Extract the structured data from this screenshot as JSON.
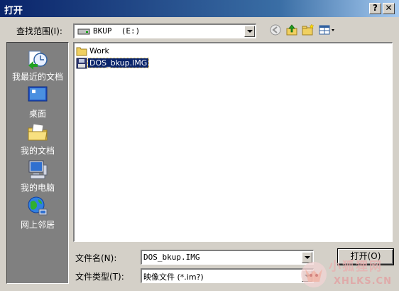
{
  "window": {
    "title": "打开",
    "help_label": "?",
    "close_label": "✕"
  },
  "lookin": {
    "label": "查找范围(I):",
    "value": "BKUP  (E:)"
  },
  "toolbar": {
    "icons": [
      "back-icon",
      "up-folder-icon",
      "new-folder-icon",
      "view-menu-icon"
    ]
  },
  "places": [
    {
      "label": "我最近的文档",
      "icon": "recent-documents-icon"
    },
    {
      "label": "桌面",
      "icon": "desktop-icon"
    },
    {
      "label": "我的文档",
      "icon": "my-documents-icon"
    },
    {
      "label": "我的电脑",
      "icon": "my-computer-icon"
    },
    {
      "label": "网上邻居",
      "icon": "network-places-icon"
    }
  ],
  "files": [
    {
      "name": "Work",
      "type": "folder",
      "selected": false
    },
    {
      "name": "DOS_bkup.IMG",
      "type": "image-file",
      "selected": true
    }
  ],
  "filename": {
    "label": "文件名(N):",
    "value": "DOS_bkup.IMG"
  },
  "filetype": {
    "label": "文件类型(T):",
    "value": "映像文件 (*.im?)"
  },
  "buttons": {
    "open": "打开(O)"
  },
  "watermark": {
    "cn": "小狐狸网",
    "en": "XHLKS.CN"
  },
  "colors": {
    "titlebar": "#0a246a",
    "dialog": "#d4d0c8",
    "places_bar": "#808080",
    "selection": "#0a246a"
  }
}
